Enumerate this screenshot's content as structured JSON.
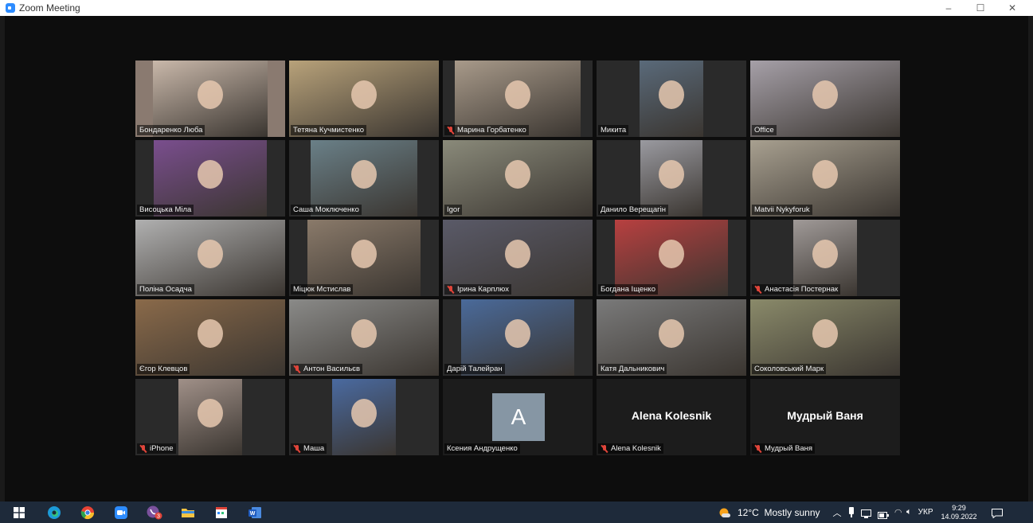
{
  "window": {
    "title": "Zoom Meeting",
    "controls": {
      "minimize": "–",
      "maximize": "☐",
      "close": "✕"
    }
  },
  "participants": [
    {
      "name": "Бондаренко Люба",
      "muted": false,
      "bg": "#8a7a70",
      "vid": "#c9b8aa"
    },
    {
      "name": "Тетяна Кучмистенко",
      "muted": false,
      "bg": "#6a6a4a",
      "vid": "#b8a27a"
    },
    {
      "name": "Марина Горбатенко",
      "muted": true,
      "bg": "#2a2a2a",
      "vid": "#a89a8a"
    },
    {
      "name": "Микита",
      "muted": false,
      "bg": "#2a2a2a",
      "vid": "#5a6a7a"
    },
    {
      "name": "Office",
      "muted": false,
      "bg": "#6a7080",
      "vid": "#a6a0a8"
    },
    {
      "name": "Висоцька Міла",
      "muted": false,
      "bg": "#2a2a2a",
      "vid": "#7a4e8e"
    },
    {
      "name": "Саша Моключенко",
      "muted": false,
      "bg": "#2a2a2a",
      "vid": "#6a8088"
    },
    {
      "name": "Igor",
      "muted": false,
      "active": true,
      "bg": "#5a5a50",
      "vid": "#8a8a7a"
    },
    {
      "name": "Данило Верещагін",
      "muted": false,
      "bg": "#2a2a2a",
      "vid": "#9a9aa0"
    },
    {
      "name": "Matvii Nykyforuk",
      "muted": false,
      "bg": "#3a4a5a",
      "vid": "#a8a090"
    },
    {
      "name": "Поліна Осадча",
      "muted": false,
      "bg": "#2a2a2a",
      "vid": "#b0b0b0"
    },
    {
      "name": "Міцюк Мстислав",
      "muted": false,
      "bg": "#2a2a2a",
      "vid": "#8a7a6a"
    },
    {
      "name": "Ірина Карплюх",
      "muted": true,
      "bg": "#3a3a40",
      "vid": "#5a5a68"
    },
    {
      "name": "Богдана Іщенко",
      "muted": false,
      "bg": "#2a2a2a",
      "vid": "#b84040"
    },
    {
      "name": "Анастасія Постернак",
      "muted": true,
      "bg": "#2a2a2a",
      "vid": "#a09a98"
    },
    {
      "name": "Єгор Клевцов",
      "muted": false,
      "bg": "#5a3a2a",
      "vid": "#8a6a4a"
    },
    {
      "name": "Антон Васильєв",
      "muted": true,
      "bg": "#3a3a3a",
      "vid": "#8a8a88"
    },
    {
      "name": "Дарій Талейран",
      "muted": false,
      "bg": "#2a2a2a",
      "vid": "#4a6a9a"
    },
    {
      "name": "Катя Дальникович",
      "muted": false,
      "bg": "#3aa0c0",
      "vid": "#7a7a7a"
    },
    {
      "name": "Соколовський Марк",
      "muted": false,
      "bg": "#4a4a40",
      "vid": "#8a8a6a"
    },
    {
      "name": "iPhone",
      "muted": true,
      "bg": "#2a2a2a",
      "vid": "#a09088"
    },
    {
      "name": "Маша",
      "muted": true,
      "bg": "#2a2a2a",
      "vid": "#4a6aa0"
    },
    {
      "name": "Ксения Андрущенко",
      "muted": false,
      "avatar": "A",
      "bg": "#1c1c1c"
    },
    {
      "name": "Alena Kolesnik",
      "muted": true,
      "big": "Alena Kolesnik",
      "bg": "#1c1c1c"
    },
    {
      "name": "Мудрый Ваня",
      "muted": true,
      "big": "Мудрый Ваня",
      "bg": "#1c1c1c"
    }
  ],
  "taskbar": {
    "apps": [
      "windows-start-icon",
      "edge-icon",
      "chrome-icon",
      "zoom-icon",
      "viber-icon",
      "file-explorer-icon",
      "video-editor-icon",
      "word-icon"
    ],
    "viber_badge": "3",
    "weather": "12°C  Mostly sunny",
    "language": "УКР",
    "time": "9:29",
    "date": "14.09.2022"
  }
}
